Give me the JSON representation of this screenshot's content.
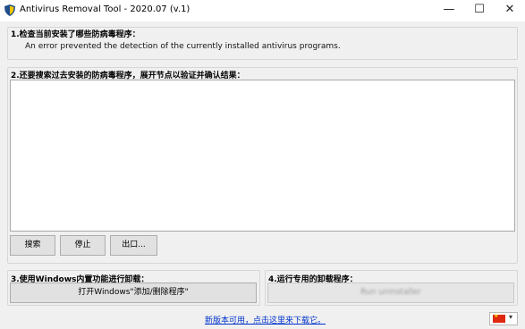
{
  "window": {
    "title": "Antivirus Removal Tool - 2020.07 (v.1)",
    "minimize_glyph": "—",
    "maximize_glyph": "☐",
    "close_glyph": "✕"
  },
  "step1": {
    "label": "1.检查当前安装了哪些防病毒程序：",
    "message": "An error prevented the detection of the currently installed antivirus programs."
  },
  "step2": {
    "label": "2.还要搜索过去安装的防病毒程序，展开节点以验证并确认结果：",
    "buttons": {
      "search": "搜索",
      "stop": "停止",
      "export": "出口..."
    }
  },
  "step3": {
    "label": "3.使用Windows内置功能进行卸载：",
    "button": "打开Windows\"添加/删除程序\""
  },
  "step4": {
    "label": "4.运行专用的卸载程序：",
    "button": "Run uninstaller"
  },
  "footer": {
    "update_link": "新版本可用，点击这里来下载它。",
    "language_icon": "china-flag-icon"
  },
  "colors": {
    "link": "#0033cc",
    "flag_red": "#de2910",
    "flag_star": "#ffde00"
  }
}
